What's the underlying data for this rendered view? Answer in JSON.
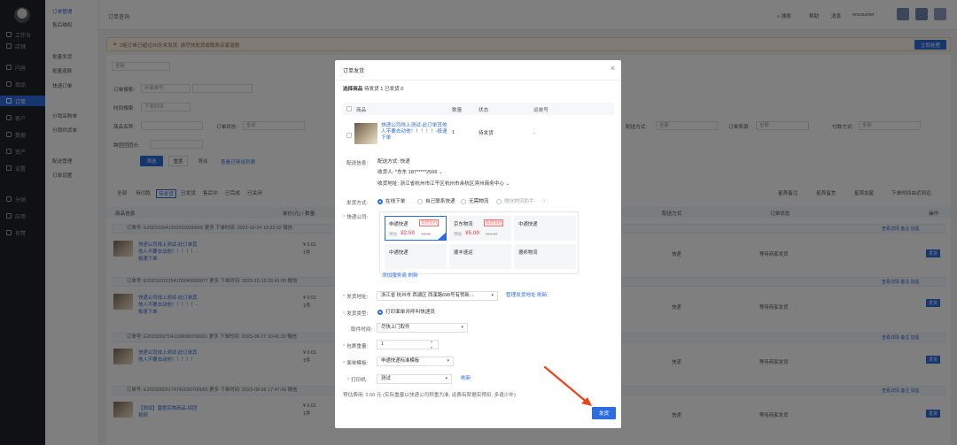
{
  "nav": {
    "items": [
      "工作台",
      "店铺",
      "内容",
      "商品",
      "订单",
      "客户",
      "数据",
      "资产",
      "设置",
      "分销",
      "应用",
      "有赞"
    ]
  },
  "subnav": {
    "items": [
      "订单管理",
      "售后维权",
      "批量发货",
      "批量退款",
      "快递订单",
      "分销采购单",
      "分销供货单",
      "配送管理",
      "订单设置"
    ]
  },
  "topbar": {
    "title": "订单查询",
    "links": [
      "搜索",
      "帮助",
      "消息",
      "encounter"
    ]
  },
  "notice": {
    "text": "3笔订单已超过30天未发货, 请尽快发货或联系买家退款",
    "button": "立即处理"
  },
  "filters": {
    "all_label": "全部",
    "order_search_label": "订单搜索:",
    "order_search_type": "外部单号",
    "time_label": "时间搜索:",
    "time_type": "下单时间",
    "product_label": "商品名称:",
    "order_state_label": "订单状态:",
    "delivery_label": "配送方式:",
    "source_label": "订单来源:",
    "pay_label": "付款方式:",
    "any": "全部",
    "extra_label": "跨团团团长:",
    "btn_filter": "筛选",
    "btn_reset": "重置",
    "btn_export": "导出",
    "export_list": "查看已导出列表"
  },
  "tabs": [
    "全部",
    "待付款",
    "待发货",
    "已发货",
    "售后中",
    "已完成",
    "已关闭"
  ],
  "tabs_right": [
    "星首备注",
    "星首留言",
    "星首加星",
    "下单时间由近到远"
  ],
  "table_head": {
    "goods": "商品信息",
    "price": "单价(元) / 数量",
    "delivery": "配送方式",
    "state": "订单状态",
    "ops": "操作"
  },
  "orders": [
    {
      "head": "订单号: E20231024133301025000S  更多   下单时间: 2023-10-24 13:33:02  微信",
      "name": "快递公司线上测试-此订单其他人不要去动他！！！！！-极速下单",
      "price": "¥ 0.01",
      "qty": "1件",
      "ship": "快递",
      "state": "等待商家发货",
      "ops": "查看详情  备注  加星",
      "btn": "发货"
    },
    {
      "head": "订单号: E20231010154105049300077  更多   下单时间: 2023-10-10 15:41:06  微信",
      "name": "快递公司线上测试-此订单其他人不要去动他！！！！！-极速下单",
      "price": "¥ 0.01",
      "qty": "1件",
      "ship": "快递",
      "state": "等待商家发货",
      "ops": "查看详情  备注  加星",
      "btn": "发货"
    },
    {
      "head": "订单号: E20230927041109090700061  更多   下单时间: 2023-09-27 10:41:20  微信",
      "name": "快递公司线上测试-此订单其他人不要去动他！！！！！",
      "price": "¥ 0.01",
      "qty": "1件",
      "ship": "快递",
      "state": "等待商家发货",
      "ops": "查看详情  备注  加星",
      "btn": "发货"
    },
    {
      "head": "订单号: E20230926174742030700065  更多   下单时间: 2023-09-26 17:47:43  微信",
      "name": "【测试】雷霆实物商品-拼团视频",
      "price": "¥ 0.01",
      "qty": "1件",
      "ship": "快递",
      "state": "等待商家发货",
      "ops": "查看详情  备注  加星",
      "btn": "发货"
    }
  ],
  "modal": {
    "title": "订单发货",
    "select_label": "选择商品",
    "select_stat": "待发货 1  已发货 0",
    "head_goods": "商品",
    "head_qty": "数量",
    "head_state": "状态",
    "head_track": "运单号",
    "product_name": "快递公司线上测试-此订单其他人不要去动他！！！！！-极速下单",
    "product_qty": "1",
    "product_state": "待发货",
    "product_track": "-",
    "info_label": "配送信息:",
    "info_method": "配送方式: 快递",
    "info_receiver": "收货人: *东东 187*****2566",
    "info_address": "收货地址: 浙江省杭州市江干区杭州市余杭区滨州商务中心",
    "method_label": "发货方式:",
    "methods": [
      "在线下单",
      "自己联系快递",
      "无需物流",
      "微信物流助手"
    ],
    "courier_label": "快递公司:",
    "couriers": [
      {
        "name": "申通快递",
        "tag": "有赞签约",
        "est": "预估",
        "price": "¥2.50",
        "orig": "¥3.00"
      },
      {
        "name": "京东物流",
        "tag": "有赞签约",
        "est": "预估",
        "price": "¥5.00",
        "orig": "¥12.00"
      },
      {
        "name": "中通快递",
        "tag": "",
        "est": "",
        "price": "",
        "orig": ""
      },
      {
        "name": "中通快递",
        "tag": "",
        "est": "",
        "price": "",
        "orig": ""
      },
      {
        "name": "顺丰速运",
        "tag": "",
        "est": "",
        "price": "",
        "orig": ""
      },
      {
        "name": "德邦物流",
        "tag": "",
        "est": "",
        "price": "",
        "orig": ""
      }
    ],
    "add_service": "添加服务商",
    "refresh": "刷新",
    "from_label": "发货地址:",
    "from_value": "浙江省 杭州市 西湖区 西溪路698号有赞新...",
    "manage_addr": "管理发货地址",
    "type_label": "发货类型:",
    "type_value": "打印面单并呼叫快递员",
    "pickup_label": "取件时间:",
    "pickup_value": "尽快上门取件",
    "weight_label": "包裹重量:",
    "weight_value": "1",
    "template_label": "面单模板:",
    "template_value": "申通快递标准模板",
    "printer_label": "打印机:",
    "printer_value": "测试",
    "estimate": "预估费用: 2.50 元 (实际重量以快递公司称重为准, 运费有赞据实预扣, 多退少补)",
    "ship_button": "发货"
  },
  "colors": {
    "accent": "#2d6cdf",
    "danger": "#f56c6c",
    "nav": "#1f2329",
    "arrow": "#f0411a"
  }
}
